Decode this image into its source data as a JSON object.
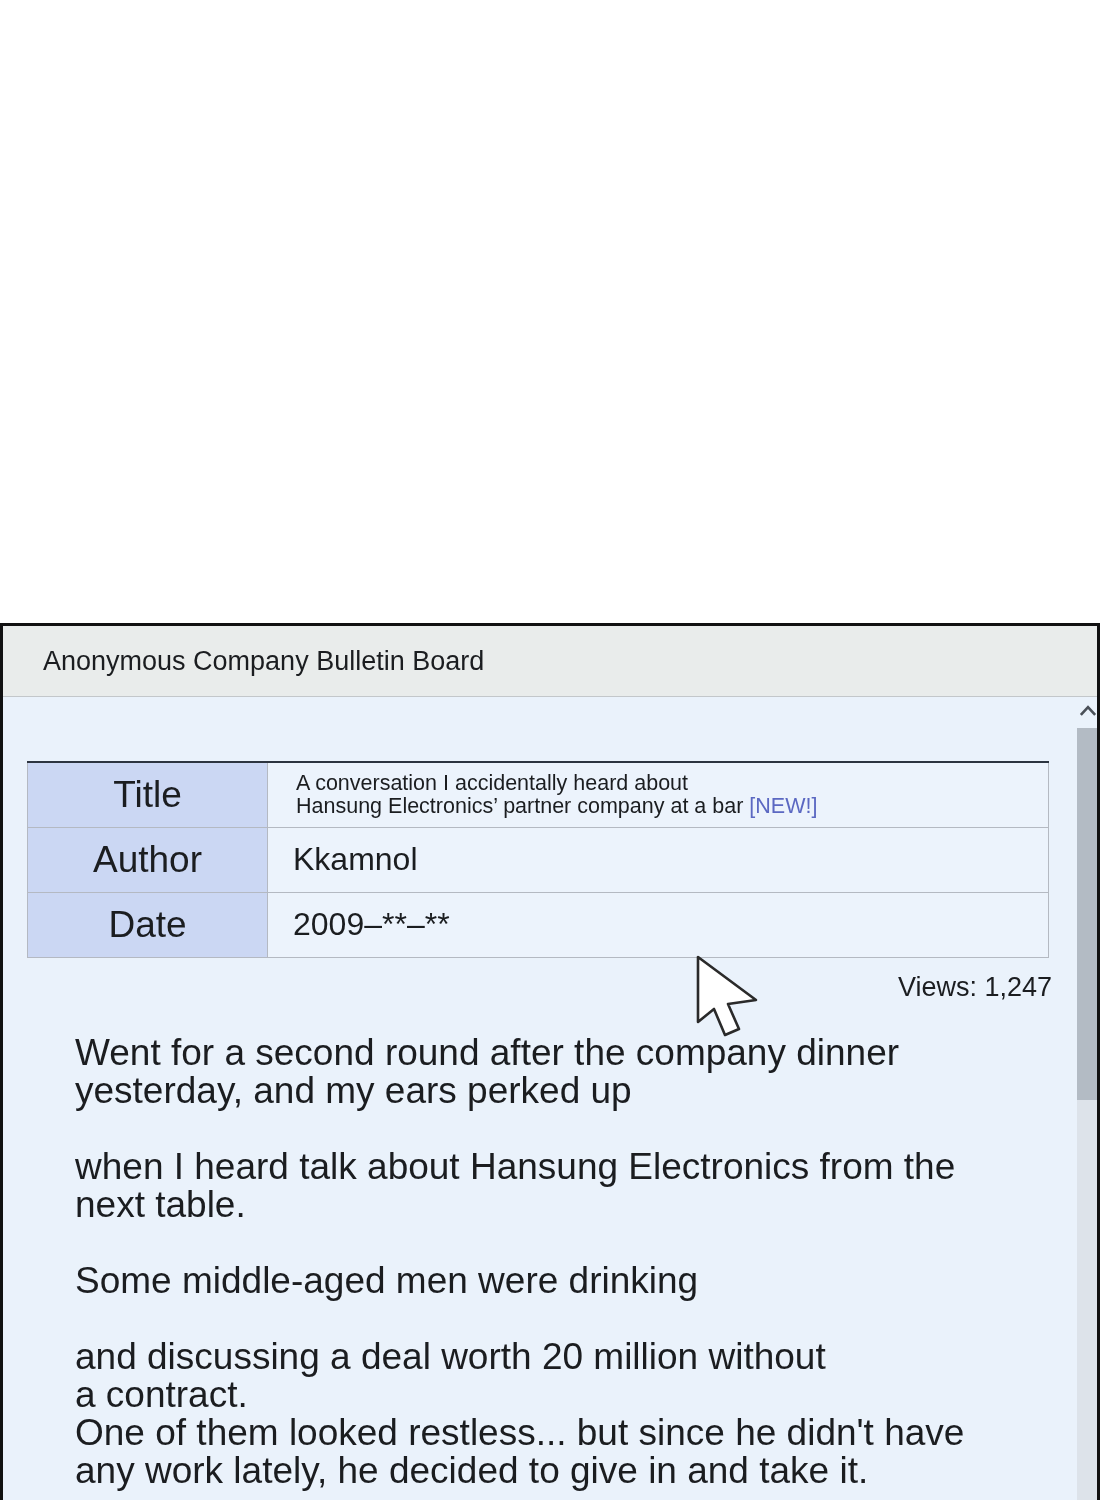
{
  "window": {
    "title": "Anonymous Company Bulletin Board"
  },
  "post": {
    "fields": [
      {
        "kind": "title",
        "label": "Title",
        "value": "A conversation I accidentally heard about\nHansung Electronics’ partner company at a bar",
        "badge": "[NEW!]"
      },
      {
        "kind": "plain",
        "label": "Author",
        "value": "Kkamnol"
      },
      {
        "kind": "plain",
        "label": "Date",
        "value": "2009–**–**"
      }
    ],
    "views": "Views: 1,247",
    "body": [
      "Went for a second round after the company dinner\nyesterday, and my ears perked up",
      "when I heard talk about Hansung Electronics from the\nnext table.",
      "Some middle-aged men were drinking",
      "and discussing a deal worth 20 million without\na contract.\nOne of them looked restless... but since he didn't have\nany work lately, he decided to give in and take it."
    ]
  }
}
